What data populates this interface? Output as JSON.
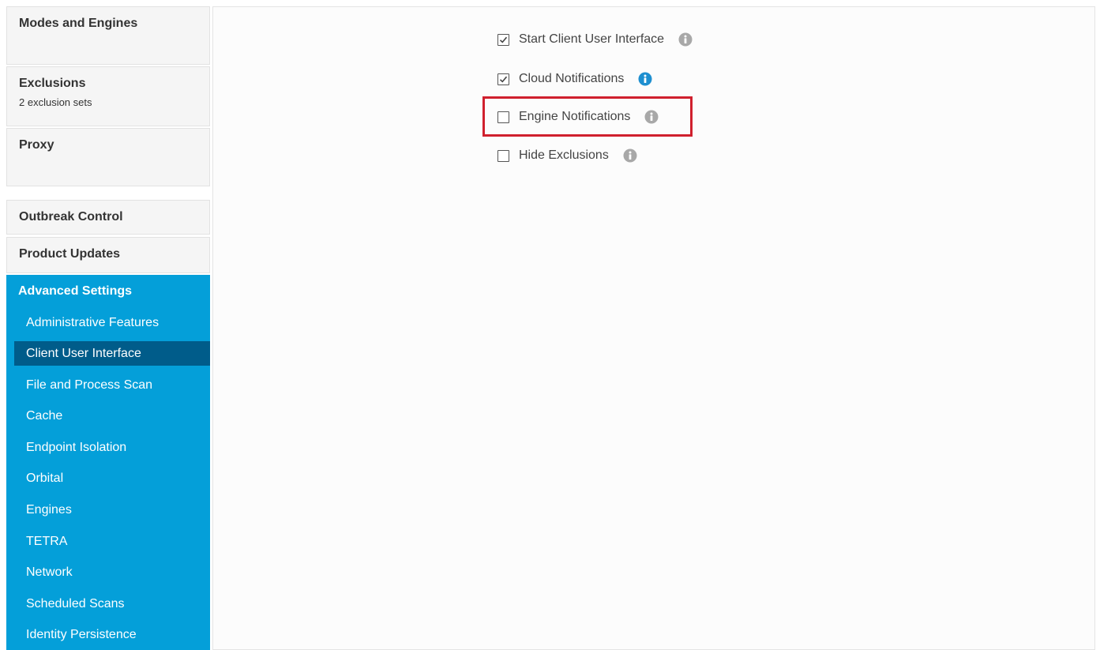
{
  "sidebar": {
    "modes": {
      "title": "Modes and Engines"
    },
    "exclusions": {
      "title": "Exclusions",
      "subtitle": "2 exclusion sets"
    },
    "proxy": {
      "title": "Proxy"
    },
    "outbreak": {
      "title": "Outbreak Control"
    },
    "updates": {
      "title": "Product Updates"
    },
    "advanced": {
      "title": "Advanced Settings",
      "items": [
        {
          "label": "Administrative Features"
        },
        {
          "label": "Client User Interface",
          "active": true
        },
        {
          "label": "File and Process Scan"
        },
        {
          "label": "Cache"
        },
        {
          "label": "Endpoint Isolation"
        },
        {
          "label": "Orbital"
        },
        {
          "label": "Engines"
        },
        {
          "label": "TETRA"
        },
        {
          "label": "Network"
        },
        {
          "label": "Scheduled Scans"
        },
        {
          "label": "Identity Persistence"
        }
      ]
    }
  },
  "options": [
    {
      "label": "Start Client User Interface",
      "checked": true,
      "info_icon": "info-icon",
      "info_color": "#a8a8a8"
    },
    {
      "label": "Cloud Notifications",
      "checked": true,
      "info_icon": "info-icon",
      "info_color": "#1e8fd0"
    },
    {
      "label": "Engine Notifications",
      "checked": false,
      "info_icon": "info-icon",
      "info_color": "#a8a8a8",
      "highlighted": true
    },
    {
      "label": "Hide Exclusions",
      "checked": false,
      "info_icon": "info-icon",
      "info_color": "#a8a8a8"
    }
  ],
  "colors": {
    "sidebar_accent": "#049fd9",
    "sidebar_active_item": "#005c8a",
    "highlight_border": "#d0202e"
  }
}
